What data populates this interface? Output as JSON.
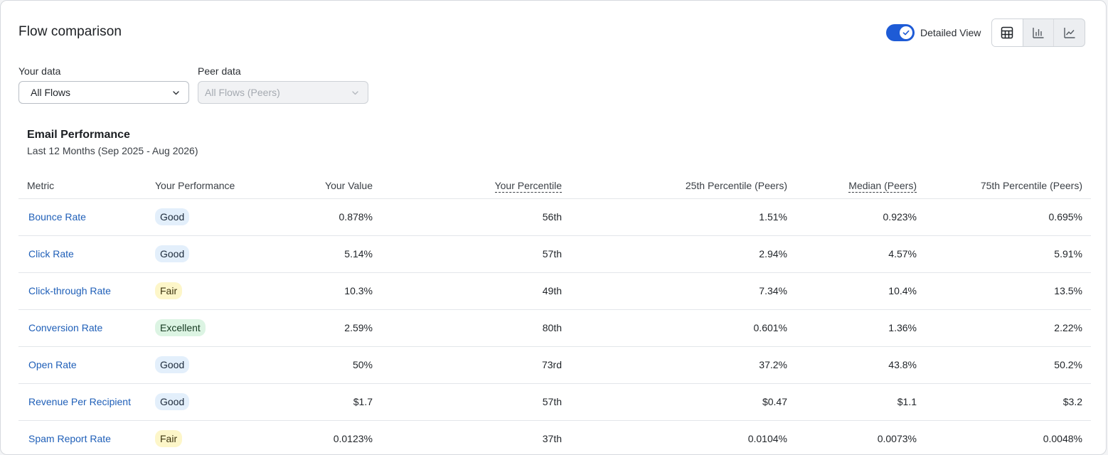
{
  "page": {
    "title": "Flow comparison"
  },
  "header": {
    "toggle_label": "Detailed View",
    "toggle_on": true,
    "views": [
      {
        "icon": "table-icon",
        "active": true
      },
      {
        "icon": "bar-chart-icon",
        "active": false
      },
      {
        "icon": "line-chart-icon",
        "active": false
      }
    ]
  },
  "filters": {
    "your_data_label": "Your data",
    "your_data_value": "All Flows",
    "peer_data_label": "Peer data",
    "peer_data_value": "All Flows (Peers)"
  },
  "section": {
    "title": "Email Performance",
    "subtitle": "Last 12 Months (Sep 2025 - Aug 2026)"
  },
  "table": {
    "headers": {
      "metric": "Metric",
      "performance": "Your Performance",
      "value": "Your Value",
      "percentile": "Your Percentile",
      "p25": "25th Percentile (Peers)",
      "median": "Median (Peers)",
      "p75": "75th Percentile (Peers)"
    },
    "rows": [
      {
        "metric": "Bounce Rate",
        "performance": "Good",
        "level": "good",
        "value": "0.878%",
        "percentile": "56th",
        "p25": "1.51%",
        "median": "0.923%",
        "p75": "0.695%"
      },
      {
        "metric": "Click Rate",
        "performance": "Good",
        "level": "good",
        "value": "5.14%",
        "percentile": "57th",
        "p25": "2.94%",
        "median": "4.57%",
        "p75": "5.91%"
      },
      {
        "metric": "Click-through Rate",
        "performance": "Fair",
        "level": "fair",
        "value": "10.3%",
        "percentile": "49th",
        "p25": "7.34%",
        "median": "10.4%",
        "p75": "13.5%"
      },
      {
        "metric": "Conversion Rate",
        "performance": "Excellent",
        "level": "excellent",
        "value": "2.59%",
        "percentile": "80th",
        "p25": "0.601%",
        "median": "1.36%",
        "p75": "2.22%"
      },
      {
        "metric": "Open Rate",
        "performance": "Good",
        "level": "good",
        "value": "50%",
        "percentile": "73rd",
        "p25": "37.2%",
        "median": "43.8%",
        "p75": "50.2%"
      },
      {
        "metric": "Revenue Per Recipient",
        "performance": "Good",
        "level": "good",
        "value": "$1.7",
        "percentile": "57th",
        "p25": "$0.47",
        "median": "$1.1",
        "p75": "$3.2"
      },
      {
        "metric": "Spam Report Rate",
        "performance": "Fair",
        "level": "fair",
        "value": "0.0123%",
        "percentile": "37th",
        "p25": "0.0104%",
        "median": "0.0073%",
        "p75": "0.0048%"
      }
    ]
  },
  "colors": {
    "accent": "#1e5bd6",
    "link": "#1f5fb8",
    "good": "#e3effb",
    "fair": "#fdf6c9",
    "excellent": "#dcf4e3"
  }
}
